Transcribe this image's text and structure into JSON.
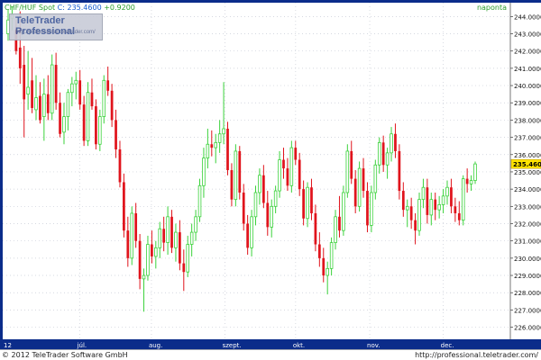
{
  "header": {
    "symbol": "CHF/HUF Spot",
    "quote": "C: 235.4600",
    "change": "+0.9200",
    "period": "naponta"
  },
  "logo": {
    "brand": "TeleTrader Professional",
    "url": "http://professional.teletrader.com/"
  },
  "footer": {
    "copyright": "© 2012 TeleTrader Software GmbH",
    "url": "http://professional.teletrader.com/"
  },
  "colors": {
    "up": "#3bd23b",
    "down": "#e0141c",
    "frame": "#0b2c8a",
    "last_price_bg": "#ffe400"
  },
  "chart_data": {
    "type": "candlestick",
    "title": "CHF/HUF Spot",
    "y_axis": {
      "side": "right",
      "ticks": [
        226,
        227,
        228,
        229,
        230,
        231,
        232,
        233,
        234,
        235,
        236,
        237,
        238,
        239,
        240,
        241,
        242,
        243,
        244
      ],
      "tick_labels": [
        "226.0000",
        "227.0000",
        "228.0000",
        "229.0000",
        "230.0000",
        "231.0000",
        "232.0000",
        "233.0000",
        "234.0000",
        "235.0000",
        "236.0000",
        "237.0000",
        "238.0000",
        "239.0000",
        "240.0000",
        "241.0000",
        "242.0000",
        "243.0000",
        "244.0000"
      ],
      "range": [
        225.3,
        244.8
      ],
      "last_price_label": "235.4600",
      "last_price": 235.46
    },
    "x_axis": {
      "labels": [
        "12",
        "júl.",
        "aug.",
        "szept.",
        "okt.",
        "nov.",
        "dec."
      ],
      "label_fractions": [
        0.0,
        0.152,
        0.293,
        0.438,
        0.577,
        0.723,
        0.868
      ]
    },
    "grid": true,
    "series": [
      {
        "ohlc": [
          [
            243.0,
            244.4,
            242.6,
            243.8
          ],
          [
            243.9,
            244.6,
            243.2,
            244.1
          ],
          [
            243.2,
            243.8,
            241.8,
            242.0
          ],
          [
            242.2,
            244.3,
            240.1,
            241.0
          ],
          [
            241.2,
            242.3,
            237.0,
            239.2
          ],
          [
            239.5,
            242.0,
            238.6,
            239.9
          ],
          [
            240.3,
            241.6,
            238.4,
            238.7
          ],
          [
            238.6,
            240.6,
            238.0,
            239.3
          ],
          [
            239.4,
            240.2,
            237.8,
            238.0
          ],
          [
            238.2,
            240.4,
            236.8,
            239.5
          ],
          [
            239.5,
            240.6,
            238.0,
            238.4
          ],
          [
            238.4,
            241.8,
            238.0,
            241.2
          ],
          [
            241.2,
            241.9,
            238.6,
            239.0
          ],
          [
            239.0,
            239.6,
            237.0,
            237.2
          ],
          [
            237.3,
            239.0,
            236.6,
            238.2
          ],
          [
            238.2,
            239.8,
            237.4,
            239.6
          ],
          [
            239.6,
            240.5,
            238.8,
            240.1
          ],
          [
            240.1,
            240.8,
            239.2,
            240.3
          ],
          [
            240.3,
            240.9,
            238.6,
            238.9
          ],
          [
            238.9,
            239.4,
            236.5,
            236.8
          ],
          [
            236.8,
            240.2,
            236.5,
            239.6
          ],
          [
            239.6,
            240.4,
            238.6,
            238.8
          ],
          [
            238.8,
            239.2,
            236.3,
            236.6
          ],
          [
            236.6,
            238.6,
            236.2,
            238.2
          ],
          [
            238.2,
            240.6,
            237.8,
            240.3
          ],
          [
            240.3,
            241.1,
            239.4,
            239.7
          ],
          [
            239.7,
            240.1,
            237.6,
            238.0
          ],
          [
            238.0,
            238.6,
            235.8,
            236.3
          ],
          [
            236.3,
            236.8,
            234.1,
            234.4
          ],
          [
            234.4,
            234.9,
            231.2,
            231.6
          ],
          [
            231.6,
            232.4,
            229.5,
            230.0
          ],
          [
            230.0,
            233.0,
            229.6,
            232.6
          ],
          [
            232.6,
            233.2,
            230.6,
            231.0
          ],
          [
            231.0,
            231.4,
            228.2,
            228.8
          ],
          [
            228.8,
            229.4,
            226.9,
            229.0
          ],
          [
            229.0,
            231.3,
            228.7,
            230.8
          ],
          [
            230.8,
            231.6,
            229.7,
            230.1
          ],
          [
            230.1,
            231.0,
            229.4,
            230.6
          ],
          [
            230.6,
            232.1,
            230.0,
            231.7
          ],
          [
            231.7,
            232.4,
            230.4,
            230.9
          ],
          [
            230.9,
            233.0,
            230.2,
            232.4
          ],
          [
            232.4,
            232.8,
            230.3,
            230.6
          ],
          [
            230.6,
            232.0,
            229.8,
            231.5
          ],
          [
            231.5,
            232.2,
            229.3,
            229.7
          ],
          [
            229.7,
            230.5,
            228.1,
            229.2
          ],
          [
            229.2,
            231.3,
            228.9,
            230.8
          ],
          [
            230.8,
            232.0,
            230.1,
            231.5
          ],
          [
            231.5,
            232.8,
            231.0,
            232.4
          ],
          [
            232.4,
            234.6,
            232.1,
            234.2
          ],
          [
            234.2,
            236.4,
            233.5,
            235.8
          ],
          [
            235.8,
            237.5,
            235.2,
            236.6
          ],
          [
            236.6,
            237.4,
            235.9,
            236.4
          ],
          [
            236.4,
            237.2,
            235.5,
            236.7
          ],
          [
            236.7,
            238.0,
            236.1,
            237.2
          ],
          [
            237.2,
            240.2,
            236.6,
            237.5
          ],
          [
            237.5,
            237.9,
            234.8,
            235.1
          ],
          [
            235.1,
            235.5,
            233.0,
            233.4
          ],
          [
            233.4,
            236.6,
            233.0,
            236.2
          ],
          [
            236.2,
            236.5,
            233.4,
            233.8
          ],
          [
            233.8,
            234.3,
            231.6,
            232.0
          ],
          [
            232.0,
            232.5,
            230.2,
            230.6
          ],
          [
            230.6,
            232.8,
            230.1,
            232.4
          ],
          [
            232.4,
            234.2,
            231.9,
            233.8
          ],
          [
            233.8,
            235.2,
            233.1,
            234.8
          ],
          [
            234.8,
            235.4,
            232.9,
            233.2
          ],
          [
            233.2,
            233.9,
            231.3,
            231.8
          ],
          [
            231.8,
            233.4,
            231.2,
            233.0
          ],
          [
            233.0,
            234.2,
            232.6,
            233.9
          ],
          [
            233.9,
            236.2,
            233.5,
            235.7
          ],
          [
            235.7,
            236.4,
            234.6,
            235.2
          ],
          [
            235.2,
            235.8,
            233.9,
            234.2
          ],
          [
            234.2,
            236.8,
            233.8,
            236.4
          ],
          [
            236.4,
            236.8,
            235.4,
            235.7
          ],
          [
            235.7,
            236.1,
            233.6,
            234.0
          ],
          [
            234.0,
            234.5,
            231.9,
            232.3
          ],
          [
            232.3,
            234.4,
            231.8,
            234.1
          ],
          [
            234.1,
            234.6,
            232.2,
            232.6
          ],
          [
            232.6,
            233.1,
            230.4,
            230.8
          ],
          [
            230.8,
            231.5,
            229.5,
            230.0
          ],
          [
            230.0,
            230.6,
            228.6,
            229.0
          ],
          [
            229.0,
            229.8,
            227.9,
            229.4
          ],
          [
            229.4,
            231.2,
            229.0,
            230.9
          ],
          [
            230.9,
            232.8,
            230.5,
            232.4
          ],
          [
            232.4,
            233.6,
            231.2,
            231.6
          ],
          [
            231.6,
            234.2,
            231.3,
            233.8
          ],
          [
            233.8,
            236.6,
            233.5,
            236.2
          ],
          [
            236.2,
            236.8,
            234.3,
            234.6
          ],
          [
            234.6,
            235.1,
            232.6,
            233.0
          ],
          [
            233.0,
            235.6,
            232.7,
            235.2
          ],
          [
            235.2,
            235.8,
            233.5,
            233.9
          ],
          [
            233.9,
            234.4,
            231.5,
            231.9
          ],
          [
            231.9,
            234.2,
            231.5,
            233.8
          ],
          [
            233.8,
            235.7,
            233.4,
            235.4
          ],
          [
            235.4,
            237.0,
            234.9,
            236.7
          ],
          [
            236.7,
            237.1,
            235.0,
            235.4
          ],
          [
            235.4,
            236.4,
            234.6,
            236.1
          ],
          [
            236.1,
            237.6,
            235.6,
            237.2
          ],
          [
            237.2,
            237.8,
            235.8,
            236.2
          ],
          [
            236.2,
            236.6,
            233.4,
            233.9
          ],
          [
            233.9,
            234.4,
            232.4,
            232.8
          ],
          [
            232.8,
            233.4,
            231.8,
            233.0
          ],
          [
            233.0,
            233.5,
            231.7,
            232.2
          ],
          [
            232.2,
            232.6,
            230.8,
            231.6
          ],
          [
            231.6,
            233.8,
            231.3,
            233.4
          ],
          [
            233.4,
            234.6,
            232.9,
            234.1
          ],
          [
            234.1,
            234.6,
            232.0,
            232.5
          ],
          [
            232.5,
            233.8,
            231.9,
            233.4
          ],
          [
            233.4,
            233.8,
            232.2,
            232.8
          ],
          [
            232.8,
            233.6,
            232.3,
            233.1
          ],
          [
            233.1,
            234.0,
            232.6,
            233.6
          ],
          [
            233.6,
            234.5,
            233.1,
            234.1
          ],
          [
            234.1,
            234.6,
            232.6,
            233.0
          ],
          [
            233.0,
            233.5,
            232.1,
            232.6
          ],
          [
            232.6,
            233.3,
            231.9,
            232.2
          ],
          [
            232.2,
            234.8,
            231.9,
            234.6
          ],
          [
            234.6,
            235.2,
            233.8,
            234.3
          ],
          [
            234.3,
            234.8,
            233.9,
            234.5
          ],
          [
            234.5,
            235.6,
            234.3,
            235.46
          ]
        ]
      }
    ]
  }
}
